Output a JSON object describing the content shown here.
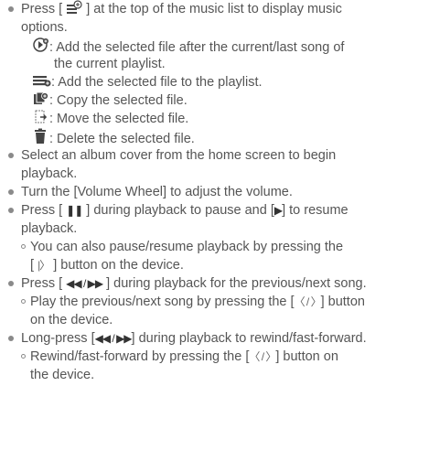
{
  "intro": {
    "text_a": "Press [",
    "text_b": "] at the top of the music list to display music",
    "text_c": "options."
  },
  "options": [
    {
      "icon": "add-after-icon",
      "line1": ": Add the selected file after the current/last song of",
      "line2": "the current playlist."
    },
    {
      "icon": "add-to-playlist-icon",
      "line1": ": Add the selected file to the playlist."
    },
    {
      "icon": "copy-file-icon",
      "line1": ": Copy the selected file."
    },
    {
      "icon": "move-file-icon",
      "line1": ": Move the selected file."
    },
    {
      "icon": "trash-icon",
      "line1": ": Delete the selected file."
    }
  ],
  "items": {
    "album_1": "Select an album cover from the home screen to begin",
    "album_2": "playback.",
    "volume": "Turn the [Volume Wheel] to adjust the volume.",
    "pause_a": "Press [",
    "pause_b": "] during playback to pause and [",
    "pause_c": "] to resume",
    "pause_2": "playback.",
    "pause_sub1_1": "You can also pause/resume playback by pressing the",
    "pause_sub1_2a": "[",
    "pause_sub1_2b": "] button on the device.",
    "prev_a": "Press [",
    "prev_b": "] during playback for the previous/next song.",
    "prev_sub1_1a": "Play the previous/next song by pressing the [",
    "prev_sub1_1b": "] button",
    "prev_sub1_2": "on the device.",
    "long_a": "Long-press [",
    "long_b": "] during playback to rewind/fast-forward.",
    "long_sub1_1a": "Rewind/fast-forward by pressing the [",
    "long_sub1_1b": "] button on",
    "long_sub1_2": "the device."
  },
  "glyphs": {
    "pause": "❚❚",
    "play": "▶",
    "play_pause_device": "|〉",
    "prev_next": "◀◀ / ▶▶",
    "device_prev_next": "〈 / 〉"
  }
}
